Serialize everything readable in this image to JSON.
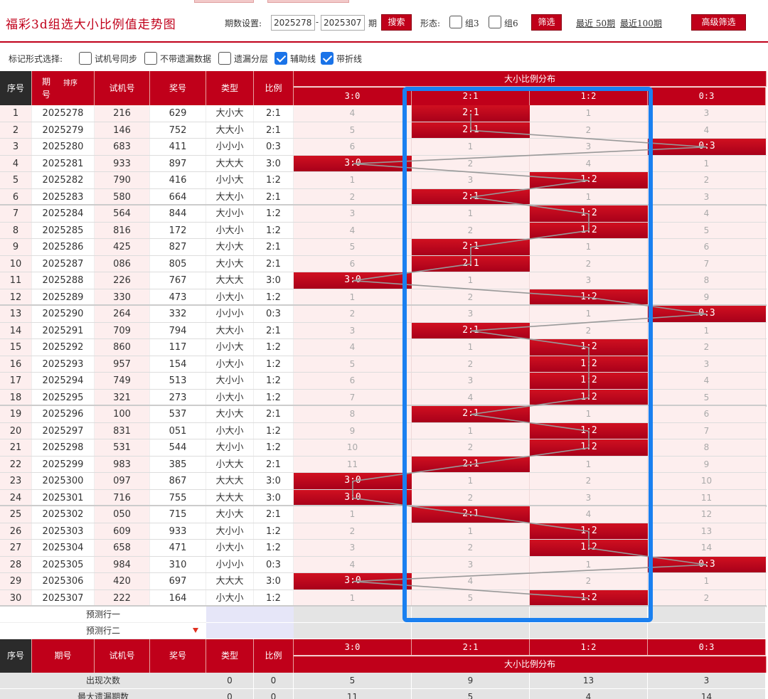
{
  "header": {
    "title": "福彩3d组选大小比例值走势图",
    "period_label": "期数设置:",
    "period_start": "2025278",
    "period_dash": "-",
    "period_end": "2025307",
    "period_unit": "期",
    "search_button": "搜索",
    "shape_label": "形态:",
    "group3_label": "组3",
    "group6_label": "组6",
    "filter_button": "筛选",
    "recent50": "最近 50期",
    "recent100": "最近100期",
    "advanced_button": "高级筛选"
  },
  "options": {
    "label": "标记形式选择:",
    "items": [
      {
        "label": "试机号同步",
        "checked": false
      },
      {
        "label": "不带遗漏数据",
        "checked": false
      },
      {
        "label": "遗漏分层",
        "checked": false
      },
      {
        "label": "辅助线",
        "checked": true
      },
      {
        "label": "带折线",
        "checked": true
      }
    ]
  },
  "table": {
    "headers": {
      "seq": "序号",
      "issue": "期号",
      "sort": "排序",
      "trial": "试机号",
      "prize": "奖号",
      "type": "类型",
      "ratio": "比例",
      "dist": "大小比例分布"
    },
    "dist_columns": [
      "3:0",
      "2:1",
      "1:2",
      "0:3"
    ],
    "rows": [
      {
        "seq": "1",
        "issue": "2025278",
        "trial": "216",
        "prize": "629",
        "type": "大小大",
        "ratio": "2:1",
        "miss": [
          "4",
          "2:1",
          "1",
          "3"
        ]
      },
      {
        "seq": "2",
        "issue": "2025279",
        "trial": "146",
        "prize": "752",
        "type": "大大小",
        "ratio": "2:1",
        "miss": [
          "5",
          "2:1",
          "2",
          "4"
        ]
      },
      {
        "seq": "3",
        "issue": "2025280",
        "trial": "683",
        "prize": "411",
        "type": "小小小",
        "ratio": "0:3",
        "miss": [
          "6",
          "1",
          "3",
          "0:3"
        ]
      },
      {
        "seq": "4",
        "issue": "2025281",
        "trial": "933",
        "prize": "897",
        "type": "大大大",
        "ratio": "3:0",
        "miss": [
          "3:0",
          "2",
          "4",
          "1"
        ]
      },
      {
        "seq": "5",
        "issue": "2025282",
        "trial": "790",
        "prize": "416",
        "type": "小小大",
        "ratio": "1:2",
        "miss": [
          "1",
          "3",
          "1:2",
          "2"
        ]
      },
      {
        "seq": "6",
        "issue": "2025283",
        "trial": "580",
        "prize": "664",
        "type": "大大小",
        "ratio": "2:1",
        "miss": [
          "2",
          "2:1",
          "1",
          "3"
        ]
      },
      {
        "seq": "7",
        "issue": "2025284",
        "trial": "564",
        "prize": "844",
        "type": "大小小",
        "ratio": "1:2",
        "miss": [
          "3",
          "1",
          "1:2",
          "4"
        ]
      },
      {
        "seq": "8",
        "issue": "2025285",
        "trial": "816",
        "prize": "172",
        "type": "小大小",
        "ratio": "1:2",
        "miss": [
          "4",
          "2",
          "1:2",
          "5"
        ]
      },
      {
        "seq": "9",
        "issue": "2025286",
        "trial": "425",
        "prize": "827",
        "type": "大小大",
        "ratio": "2:1",
        "miss": [
          "5",
          "2:1",
          "1",
          "6"
        ]
      },
      {
        "seq": "10",
        "issue": "2025287",
        "trial": "086",
        "prize": "805",
        "type": "大小大",
        "ratio": "2:1",
        "miss": [
          "6",
          "2:1",
          "2",
          "7"
        ]
      },
      {
        "seq": "11",
        "issue": "2025288",
        "trial": "226",
        "prize": "767",
        "type": "大大大",
        "ratio": "3:0",
        "miss": [
          "3:0",
          "1",
          "3",
          "8"
        ]
      },
      {
        "seq": "12",
        "issue": "2025289",
        "trial": "330",
        "prize": "473",
        "type": "小大小",
        "ratio": "1:2",
        "miss": [
          "1",
          "2",
          "1:2",
          "9"
        ]
      },
      {
        "seq": "13",
        "issue": "2025290",
        "trial": "264",
        "prize": "332",
        "type": "小小小",
        "ratio": "0:3",
        "miss": [
          "2",
          "3",
          "1",
          "0:3"
        ]
      },
      {
        "seq": "14",
        "issue": "2025291",
        "trial": "709",
        "prize": "794",
        "type": "大大小",
        "ratio": "2:1",
        "miss": [
          "3",
          "2:1",
          "2",
          "1"
        ]
      },
      {
        "seq": "15",
        "issue": "2025292",
        "trial": "860",
        "prize": "117",
        "type": "小小大",
        "ratio": "1:2",
        "miss": [
          "4",
          "1",
          "1:2",
          "2"
        ]
      },
      {
        "seq": "16",
        "issue": "2025293",
        "trial": "957",
        "prize": "154",
        "type": "小大小",
        "ratio": "1:2",
        "miss": [
          "5",
          "2",
          "1:2",
          "3"
        ]
      },
      {
        "seq": "17",
        "issue": "2025294",
        "trial": "749",
        "prize": "513",
        "type": "大小小",
        "ratio": "1:2",
        "miss": [
          "6",
          "3",
          "1:2",
          "4"
        ]
      },
      {
        "seq": "18",
        "issue": "2025295",
        "trial": "321",
        "prize": "273",
        "type": "小大小",
        "ratio": "1:2",
        "miss": [
          "7",
          "4",
          "1:2",
          "5"
        ]
      },
      {
        "seq": "19",
        "issue": "2025296",
        "trial": "100",
        "prize": "537",
        "type": "大小大",
        "ratio": "2:1",
        "miss": [
          "8",
          "2:1",
          "1",
          "6"
        ]
      },
      {
        "seq": "20",
        "issue": "2025297",
        "trial": "831",
        "prize": "051",
        "type": "小大小",
        "ratio": "1:2",
        "miss": [
          "9",
          "1",
          "1:2",
          "7"
        ]
      },
      {
        "seq": "21",
        "issue": "2025298",
        "trial": "531",
        "prize": "544",
        "type": "大小小",
        "ratio": "1:2",
        "miss": [
          "10",
          "2",
          "1:2",
          "8"
        ]
      },
      {
        "seq": "22",
        "issue": "2025299",
        "trial": "983",
        "prize": "385",
        "type": "小大大",
        "ratio": "2:1",
        "miss": [
          "11",
          "2:1",
          "1",
          "9"
        ]
      },
      {
        "seq": "23",
        "issue": "2025300",
        "trial": "097",
        "prize": "867",
        "type": "大大大",
        "ratio": "3:0",
        "miss": [
          "3:0",
          "1",
          "2",
          "10"
        ]
      },
      {
        "seq": "24",
        "issue": "2025301",
        "trial": "716",
        "prize": "755",
        "type": "大大大",
        "ratio": "3:0",
        "miss": [
          "3:0",
          "2",
          "3",
          "11"
        ]
      },
      {
        "seq": "25",
        "issue": "2025302",
        "trial": "050",
        "prize": "715",
        "type": "大小大",
        "ratio": "2:1",
        "miss": [
          "1",
          "2:1",
          "4",
          "12"
        ]
      },
      {
        "seq": "26",
        "issue": "2025303",
        "trial": "609",
        "prize": "933",
        "type": "大小小",
        "ratio": "1:2",
        "miss": [
          "2",
          "1",
          "1:2",
          "13"
        ]
      },
      {
        "seq": "27",
        "issue": "2025304",
        "trial": "658",
        "prize": "471",
        "type": "小大小",
        "ratio": "1:2",
        "miss": [
          "3",
          "2",
          "1:2",
          "14"
        ]
      },
      {
        "seq": "28",
        "issue": "2025305",
        "trial": "984",
        "prize": "310",
        "type": "小小小",
        "ratio": "0:3",
        "miss": [
          "4",
          "3",
          "1",
          "0:3"
        ]
      },
      {
        "seq": "29",
        "issue": "2025306",
        "trial": "420",
        "prize": "697",
        "type": "大大大",
        "ratio": "3:0",
        "miss": [
          "3:0",
          "4",
          "2",
          "1"
        ]
      },
      {
        "seq": "30",
        "issue": "2025307",
        "trial": "222",
        "prize": "164",
        "type": "小大小",
        "ratio": "1:2",
        "miss": [
          "1",
          "5",
          "1:2",
          "2"
        ]
      }
    ],
    "predict_rows": [
      "预测行一",
      "预测行二"
    ],
    "stats": [
      {
        "label": "出现次数",
        "type": "0",
        "ratio": "0",
        "values": [
          "5",
          "9",
          "13",
          "3"
        ]
      },
      {
        "label": "最大遗漏期数",
        "type": "0",
        "ratio": "0",
        "values": [
          "11",
          "5",
          "4",
          "14"
        ]
      }
    ]
  },
  "colors": {
    "brand_red": "#c0001a",
    "hit_red": "#c0001a",
    "row_pink": "#fdeeee",
    "highlight_blue": "#1a80f0"
  }
}
